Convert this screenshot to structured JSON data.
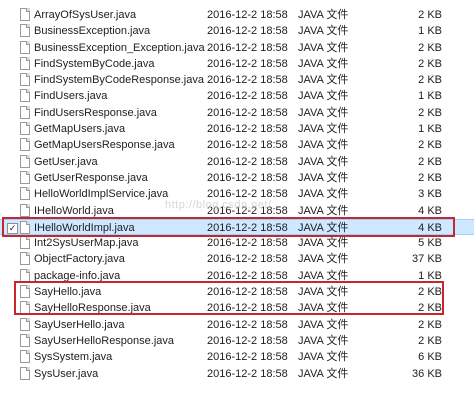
{
  "files": [
    {
      "name": "ArrayOfSysUser.java",
      "date": "2016-12-2 18:58",
      "type": "JAVA 文件",
      "size": "2 KB",
      "selected": false
    },
    {
      "name": "BusinessException.java",
      "date": "2016-12-2 18:58",
      "type": "JAVA 文件",
      "size": "1 KB",
      "selected": false
    },
    {
      "name": "BusinessException_Exception.java",
      "date": "2016-12-2 18:58",
      "type": "JAVA 文件",
      "size": "2 KB",
      "selected": false
    },
    {
      "name": "FindSystemByCode.java",
      "date": "2016-12-2 18:58",
      "type": "JAVA 文件",
      "size": "2 KB",
      "selected": false
    },
    {
      "name": "FindSystemByCodeResponse.java",
      "date": "2016-12-2 18:58",
      "type": "JAVA 文件",
      "size": "2 KB",
      "selected": false
    },
    {
      "name": "FindUsers.java",
      "date": "2016-12-2 18:58",
      "type": "JAVA 文件",
      "size": "1 KB",
      "selected": false
    },
    {
      "name": "FindUsersResponse.java",
      "date": "2016-12-2 18:58",
      "type": "JAVA 文件",
      "size": "2 KB",
      "selected": false
    },
    {
      "name": "GetMapUsers.java",
      "date": "2016-12-2 18:58",
      "type": "JAVA 文件",
      "size": "1 KB",
      "selected": false
    },
    {
      "name": "GetMapUsersResponse.java",
      "date": "2016-12-2 18:58",
      "type": "JAVA 文件",
      "size": "2 KB",
      "selected": false
    },
    {
      "name": "GetUser.java",
      "date": "2016-12-2 18:58",
      "type": "JAVA 文件",
      "size": "2 KB",
      "selected": false
    },
    {
      "name": "GetUserResponse.java",
      "date": "2016-12-2 18:58",
      "type": "JAVA 文件",
      "size": "2 KB",
      "selected": false
    },
    {
      "name": "HelloWorldImplService.java",
      "date": "2016-12-2 18:58",
      "type": "JAVA 文件",
      "size": "3 KB",
      "selected": false
    },
    {
      "name": "IHelloWorld.java",
      "date": "2016-12-2 18:58",
      "type": "JAVA 文件",
      "size": "4 KB",
      "selected": false
    },
    {
      "name": "IHelloWorldImpl.java",
      "date": "2016-12-2 18:58",
      "type": "JAVA 文件",
      "size": "4 KB",
      "selected": true
    },
    {
      "name": "Int2SysUserMap.java",
      "date": "2016-12-2 18:58",
      "type": "JAVA 文件",
      "size": "5 KB",
      "selected": false
    },
    {
      "name": "ObjectFactory.java",
      "date": "2016-12-2 18:58",
      "type": "JAVA 文件",
      "size": "37 KB",
      "selected": false
    },
    {
      "name": "package-info.java",
      "date": "2016-12-2 18:58",
      "type": "JAVA 文件",
      "size": "1 KB",
      "selected": false
    },
    {
      "name": "SayHello.java",
      "date": "2016-12-2 18:58",
      "type": "JAVA 文件",
      "size": "2 KB",
      "selected": false
    },
    {
      "name": "SayHelloResponse.java",
      "date": "2016-12-2 18:58",
      "type": "JAVA 文件",
      "size": "2 KB",
      "selected": false
    },
    {
      "name": "SayUserHello.java",
      "date": "2016-12-2 18:58",
      "type": "JAVA 文件",
      "size": "2 KB",
      "selected": false
    },
    {
      "name": "SayUserHelloResponse.java",
      "date": "2016-12-2 18:58",
      "type": "JAVA 文件",
      "size": "2 KB",
      "selected": false
    },
    {
      "name": "SysSystem.java",
      "date": "2016-12-2 18:58",
      "type": "JAVA 文件",
      "size": "6 KB",
      "selected": false
    },
    {
      "name": "SysUser.java",
      "date": "2016-12-2 18:58",
      "type": "JAVA 文件",
      "size": "36 KB",
      "selected": false
    }
  ],
  "checkbox_mark": "✓",
  "watermark": "http://blog.csdn.net/",
  "colors": {
    "annotation_box": "#c8262d",
    "selection_fill": "#cde8ff",
    "selection_border": "#99d1ff"
  }
}
